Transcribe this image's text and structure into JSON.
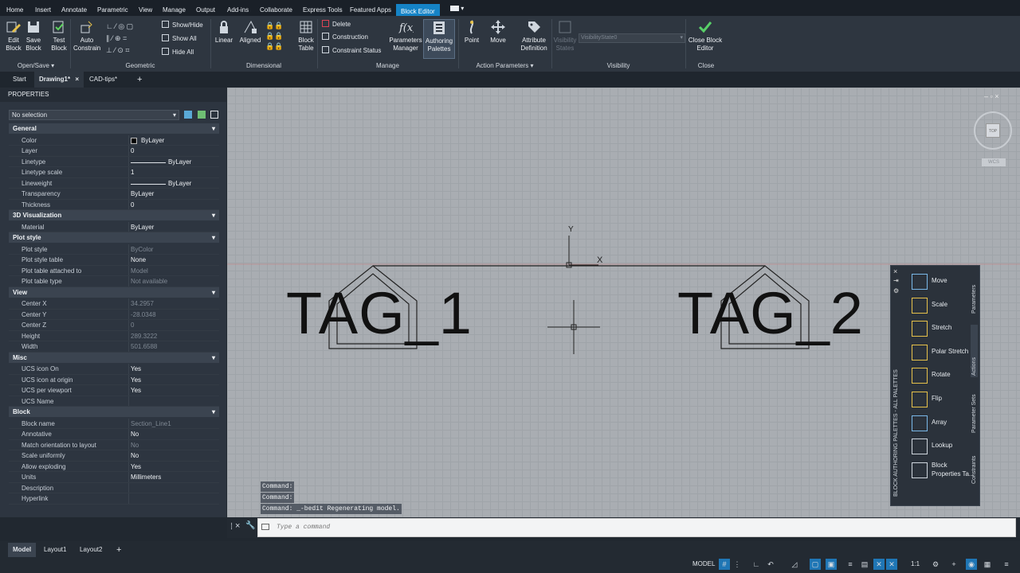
{
  "menu": [
    "Home",
    "Insert",
    "Annotate",
    "Parametric",
    "View",
    "Manage",
    "Output",
    "Add-ins",
    "Collaborate",
    "Express Tools",
    "Featured Apps",
    "Block Editor"
  ],
  "ribbon": {
    "edit_block": "Edit Block",
    "save_block": "Save Block",
    "test_block": "Test Block",
    "auto_constrain": "Auto Constrain",
    "show_hide": "Show/Hide",
    "show_all": "Show All",
    "hide_all": "Hide All",
    "linear": "Linear",
    "aligned": "Aligned",
    "block_table": "Block Table",
    "delete": "Delete",
    "construction": "Construction",
    "constraint_status": "Constraint Status",
    "parameters_manager": "Parameters Manager",
    "authoring_palettes": "Authoring Palettes",
    "point": "Point",
    "move": "Move",
    "attribute_definition": "Attribute Definition",
    "visibility_states": "Visibility States",
    "visibility_dropdown": "VisibilityState0",
    "close_block_editor": "Close Block Editor",
    "panels": {
      "open_save": "Open/Save",
      "geometric": "Geometric",
      "dimensional": "Dimensional",
      "manage": "Manage",
      "action_parameters": "Action Parameters",
      "visibility": "Visibility",
      "close": "Close"
    }
  },
  "file_tabs": [
    "Start",
    "Drawing1*",
    "CAD-tips*"
  ],
  "properties": {
    "title": "PROPERTIES",
    "selection": "No selection",
    "sections": [
      {
        "name": "General",
        "rows": [
          [
            "Color",
            "ByLayer"
          ],
          [
            "Layer",
            "0"
          ],
          [
            "Linetype",
            "ByLayer"
          ],
          [
            "Linetype scale",
            "1"
          ],
          [
            "Lineweight",
            "ByLayer"
          ],
          [
            "Transparency",
            "ByLayer"
          ],
          [
            "Thickness",
            "0"
          ]
        ]
      },
      {
        "name": "3D Visualization",
        "rows": [
          [
            "Material",
            "ByLayer"
          ]
        ]
      },
      {
        "name": "Plot style",
        "rows": [
          [
            "Plot style",
            "ByColor"
          ],
          [
            "Plot style table",
            "None"
          ],
          [
            "Plot table attached to",
            "Model"
          ],
          [
            "Plot table type",
            "Not available"
          ]
        ]
      },
      {
        "name": "View",
        "rows": [
          [
            "Center X",
            "34.2957"
          ],
          [
            "Center Y",
            "-28.0348"
          ],
          [
            "Center Z",
            "0"
          ],
          [
            "Height",
            "289.3222"
          ],
          [
            "Width",
            "501.6588"
          ]
        ]
      },
      {
        "name": "Misc",
        "rows": [
          [
            "UCS icon On",
            "Yes"
          ],
          [
            "UCS icon at origin",
            "Yes"
          ],
          [
            "UCS per viewport",
            "Yes"
          ],
          [
            "UCS Name",
            ""
          ]
        ]
      },
      {
        "name": "Block",
        "rows": [
          [
            "Block name",
            "Section_Line1"
          ],
          [
            "Annotative",
            "No"
          ],
          [
            "Match orientation to layout",
            "No"
          ],
          [
            "Scale uniformly",
            "No"
          ],
          [
            "Allow exploding",
            "Yes"
          ],
          [
            "Units",
            "Millimeters"
          ],
          [
            "Description",
            ""
          ],
          [
            "Hyperlink",
            ""
          ]
        ]
      }
    ]
  },
  "canvas": {
    "tag1": "TAG_1",
    "tag2": "TAG_2",
    "ucs_y": "Y",
    "ucs_x": "X",
    "viewcube_top": "TOP",
    "wcs": "WCS"
  },
  "palette": {
    "items": [
      "Move",
      "Scale",
      "Stretch",
      "Polar Stretch",
      "Rotate",
      "Flip",
      "Array",
      "Lookup",
      "Block Properties Ta..."
    ],
    "tabs": [
      "Parameters",
      "Actions",
      "Parameter Sets",
      "Constraints"
    ],
    "side_title": "BLOCK AUTHORING PALETTES - ALL PALETTES"
  },
  "command": {
    "history": [
      "Command:",
      "Command:",
      "Command: _-bedit Regenerating model."
    ],
    "placeholder": "Type a command"
  },
  "layout_tabs": [
    "Model",
    "Layout1",
    "Layout2"
  ],
  "status": {
    "model": "MODEL",
    "scale": "1:1"
  }
}
